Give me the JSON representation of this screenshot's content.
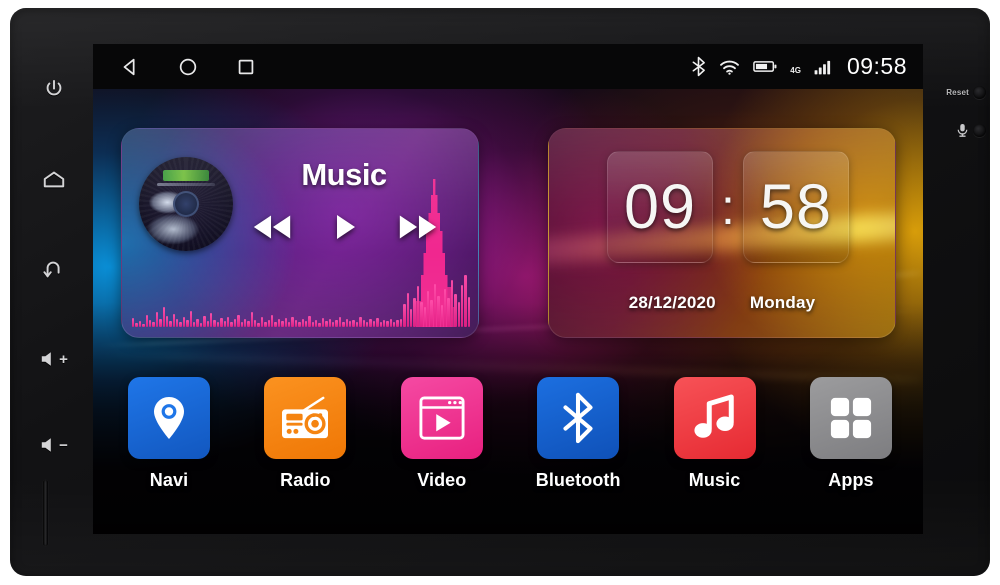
{
  "device": {
    "left_buttons": [
      {
        "name": "power",
        "label": ""
      },
      {
        "name": "home",
        "label": ""
      },
      {
        "name": "back",
        "label": ""
      },
      {
        "name": "volume-up",
        "label": "+"
      },
      {
        "name": "volume-down",
        "label": "−"
      }
    ],
    "right_bezel": {
      "reset_label": "Reset",
      "mic_label": ""
    }
  },
  "statusbar": {
    "nav": [
      {
        "name": "back",
        "glyph": "triangle-left"
      },
      {
        "name": "home",
        "glyph": "circle"
      },
      {
        "name": "recents",
        "glyph": "square"
      }
    ],
    "icons": [
      {
        "name": "bluetooth-icon"
      },
      {
        "name": "wifi-icon"
      },
      {
        "name": "battery-icon"
      },
      {
        "name": "signal-icon"
      }
    ],
    "network_label": "4G",
    "time": "09:58"
  },
  "music_widget": {
    "title": "Music",
    "controls": [
      {
        "name": "previous",
        "label": "previous-track"
      },
      {
        "name": "play",
        "label": "play"
      },
      {
        "name": "next",
        "label": "next-track"
      }
    ],
    "equalizer_levels": [
      14,
      6,
      9,
      5,
      18,
      11,
      7,
      22,
      13,
      30,
      17,
      9,
      20,
      12,
      7,
      15,
      10,
      24,
      8,
      13,
      6,
      17,
      9,
      21,
      11,
      7,
      14,
      9,
      16,
      8,
      12,
      19,
      7,
      13,
      9,
      22,
      10,
      6,
      15,
      8,
      11,
      18,
      7,
      12,
      9,
      14,
      8,
      16,
      10,
      7,
      13,
      9,
      17,
      8,
      11,
      6,
      14,
      9,
      12,
      7,
      10,
      16,
      8,
      13,
      9,
      11,
      7,
      15,
      10,
      8,
      12,
      9,
      14,
      7,
      11,
      9,
      13,
      8,
      10,
      12,
      35,
      52,
      28,
      44,
      62,
      38,
      30,
      55,
      41,
      66,
      48,
      34,
      58,
      45,
      72,
      50,
      38,
      64,
      80,
      46
    ]
  },
  "clock_widget": {
    "hours": "09",
    "minutes": "58",
    "separator": ":",
    "date": "28/12/2020",
    "weekday": "Monday"
  },
  "dock": {
    "apps": [
      {
        "label": "Navi",
        "icon": "map-pin-icon",
        "color": "#1667d6"
      },
      {
        "label": "Radio",
        "icon": "radio-icon",
        "color": "#f58410"
      },
      {
        "label": "Video",
        "icon": "video-player-icon",
        "color": "#ef2f93"
      },
      {
        "label": "Bluetooth",
        "icon": "bluetooth-icon",
        "color": "#1560d2"
      },
      {
        "label": "Music",
        "icon": "music-note-icon",
        "color": "#ef3b41"
      },
      {
        "label": "Apps",
        "icon": "grid-apps-icon",
        "color": "#8d8d8f"
      }
    ]
  }
}
